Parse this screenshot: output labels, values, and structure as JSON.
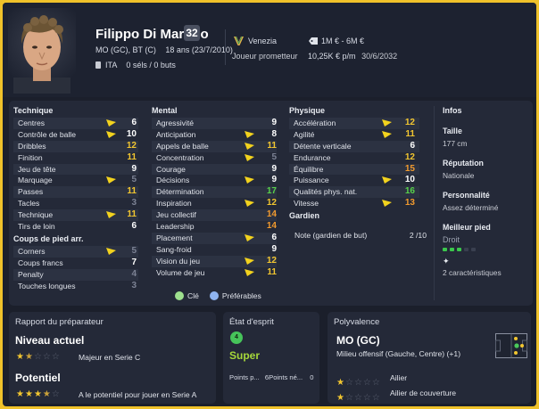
{
  "player": {
    "name": "Filippo Di Martino",
    "number": "32",
    "positions": "MO (GC), BT (C)",
    "age": "18 ans (23/7/2010)",
    "nationality": "ITA",
    "caps": "0 séls / 0 buts",
    "club": "Venezia",
    "club_status": "Joueur prometteur",
    "value": "1M € - 6M €",
    "wage": "10,25K € p/m",
    "contract_end": "30/6/2032"
  },
  "attributes": {
    "technical_title": "Technique",
    "set_pieces_title": "Coups de pied arr.",
    "mental_title": "Mental",
    "physical_title": "Physique",
    "goalkeeper_title": "Gardien",
    "technical": [
      {
        "label": "Centres",
        "value": "6",
        "color": "white",
        "arrow": true
      },
      {
        "label": "Contrôle de balle",
        "value": "10",
        "color": "white",
        "arrow": true
      },
      {
        "label": "Dribbles",
        "value": "12",
        "color": "yellow",
        "arrow": false
      },
      {
        "label": "Finition",
        "value": "11",
        "color": "yellow",
        "arrow": false
      },
      {
        "label": "Jeu de tête",
        "value": "9",
        "color": "white",
        "arrow": false
      },
      {
        "label": "Marquage",
        "value": "5",
        "color": "gray",
        "arrow": true
      },
      {
        "label": "Passes",
        "value": "11",
        "color": "yellow",
        "arrow": false
      },
      {
        "label": "Tacles",
        "value": "3",
        "color": "gray",
        "arrow": false
      },
      {
        "label": "Technique",
        "value": "11",
        "color": "yellow",
        "arrow": true
      },
      {
        "label": "Tirs de loin",
        "value": "6",
        "color": "white",
        "arrow": false
      }
    ],
    "set_pieces": [
      {
        "label": "Corners",
        "value": "5",
        "color": "gray",
        "arrow": true
      },
      {
        "label": "Coups francs",
        "value": "7",
        "color": "white",
        "arrow": false
      },
      {
        "label": "Penalty",
        "value": "4",
        "color": "gray",
        "arrow": false
      },
      {
        "label": "Touches longues",
        "value": "3",
        "color": "gray",
        "arrow": false
      }
    ],
    "mental": [
      {
        "label": "Agressivité",
        "value": "9",
        "color": "white",
        "arrow": false
      },
      {
        "label": "Anticipation",
        "value": "8",
        "color": "white",
        "arrow": true
      },
      {
        "label": "Appels de balle",
        "value": "11",
        "color": "yellow",
        "arrow": true
      },
      {
        "label": "Concentration",
        "value": "5",
        "color": "gray",
        "arrow": true
      },
      {
        "label": "Courage",
        "value": "9",
        "color": "white",
        "arrow": false
      },
      {
        "label": "Décisions",
        "value": "9",
        "color": "white",
        "arrow": true
      },
      {
        "label": "Détermination",
        "value": "17",
        "color": "green",
        "arrow": false
      },
      {
        "label": "Inspiration",
        "value": "12",
        "color": "yellow",
        "arrow": true
      },
      {
        "label": "Jeu collectif",
        "value": "14",
        "color": "orange",
        "arrow": false
      },
      {
        "label": "Leadership",
        "value": "14",
        "color": "orange",
        "arrow": false
      },
      {
        "label": "Placement",
        "value": "6",
        "color": "white",
        "arrow": true
      },
      {
        "label": "Sang-froid",
        "value": "9",
        "color": "white",
        "arrow": false
      },
      {
        "label": "Vision du jeu",
        "value": "12",
        "color": "yellow",
        "arrow": true
      },
      {
        "label": "Volume de jeu",
        "value": "11",
        "color": "yellow",
        "arrow": true
      }
    ],
    "physical": [
      {
        "label": "Accélération",
        "value": "12",
        "color": "yellow",
        "arrow": true
      },
      {
        "label": "Agilité",
        "value": "11",
        "color": "yellow",
        "arrow": true
      },
      {
        "label": "Détente verticale",
        "value": "6",
        "color": "white",
        "arrow": false
      },
      {
        "label": "Endurance",
        "value": "12",
        "color": "yellow",
        "arrow": false
      },
      {
        "label": "Équilibre",
        "value": "15",
        "color": "orange",
        "arrow": false
      },
      {
        "label": "Puissance",
        "value": "10",
        "color": "white",
        "arrow": true
      },
      {
        "label": "Qualités phys. nat.",
        "value": "16",
        "color": "green",
        "arrow": false
      },
      {
        "label": "Vitesse",
        "value": "13",
        "color": "orange",
        "arrow": true
      }
    ],
    "goalkeeper_label": "Note (gardien de but)",
    "goalkeeper_value": "2 /10",
    "legend_key": "Clé",
    "legend_preferred": "Préférables",
    "colors": {
      "white": "#ffffff",
      "yellow": "#f2c630",
      "orange": "#f29a2e",
      "green": "#58d24a",
      "gray": "#7c8294",
      "arrow": "#f2d21e"
    }
  },
  "infos": {
    "title": "Infos",
    "height_label": "Taille",
    "height_value": "177 cm",
    "reputation_label": "Réputation",
    "reputation_value": "Nationale",
    "personality_label": "Personnalité",
    "personality_value": "Assez déterminé",
    "foot_label": "Meilleur pied",
    "foot_value": "Droit",
    "foot_level": 0.6,
    "traits": "2 caractéristiques"
  },
  "coach_report": {
    "title": "Rapport du préparateur",
    "current_label": "Niveau actuel",
    "current_stars": 1.5,
    "current_text": "Majeur en Serie C",
    "potential_label": "Potentiel",
    "potential_stars": 3.5,
    "potential_text": "A le potentiel pour jouer en Serie A"
  },
  "mood": {
    "title": "État d'esprit",
    "badge": "4",
    "status": "Super",
    "points_positive": "Points p...",
    "points_negative": "6Points né...",
    "points_value": "0"
  },
  "versatility": {
    "title": "Polyvalence",
    "main_position": "MO (GC)",
    "main_description": "Milieu offensif (Gauche, Centre) (+1)",
    "roles": [
      {
        "stars": 1,
        "label": "Ailier"
      },
      {
        "stars": 1,
        "label": "Ailier de couverture"
      }
    ]
  }
}
